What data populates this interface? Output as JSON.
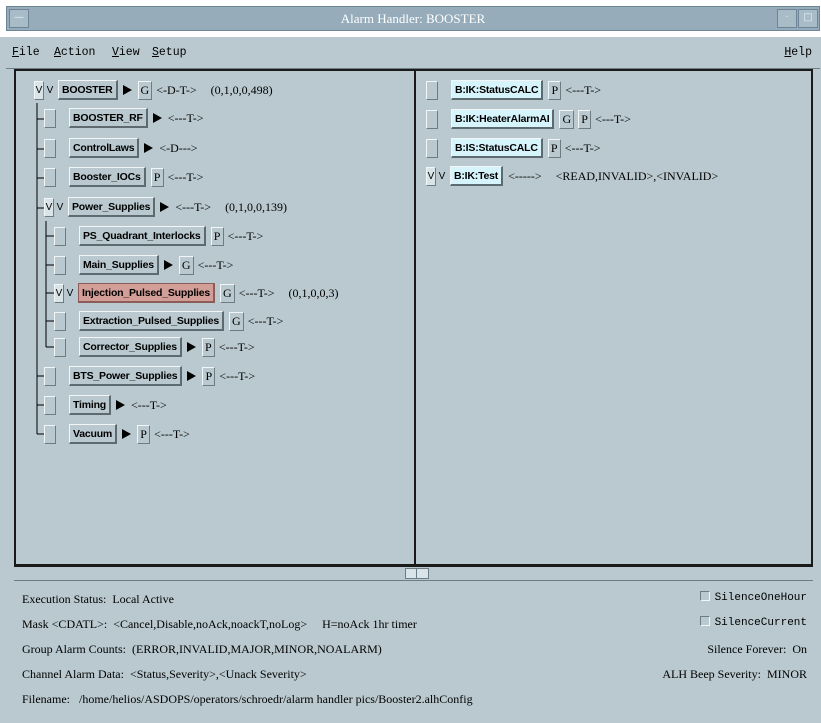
{
  "window": {
    "title": "Alarm Handler: BOOSTER"
  },
  "menubar": {
    "file": "File",
    "action": "Action",
    "view": "View",
    "setup": "Setup",
    "help": "Help"
  },
  "groups": [
    {
      "name": "BOOSTER",
      "flags": [
        "V",
        "V"
      ],
      "arrow": true,
      "buttons": [
        "G"
      ],
      "status": "<-D-T->",
      "counts": "(0,1,0,0,498)"
    },
    {
      "name": "BOOSTER_RF",
      "flags": [],
      "arrow": true,
      "buttons": [],
      "status": "<---T->",
      "counts": ""
    },
    {
      "name": "ControlLaws",
      "flags": [],
      "arrow": true,
      "buttons": [],
      "status": "<-D--->",
      "counts": ""
    },
    {
      "name": "Booster_IOCs",
      "flags": [],
      "arrow": false,
      "buttons": [
        "P"
      ],
      "status": "<---T->",
      "counts": ""
    },
    {
      "name": "Power_Supplies",
      "flags": [
        "V",
        "V"
      ],
      "arrow": true,
      "buttons": [],
      "status": "<---T->",
      "counts": "(0,1,0,0,139)"
    },
    {
      "name": "PS_Quadrant_Interlocks",
      "flags": [],
      "arrow": false,
      "buttons": [
        "P"
      ],
      "status": "<---T->",
      "counts": ""
    },
    {
      "name": "Main_Supplies",
      "flags": [],
      "arrow": true,
      "buttons": [
        "G"
      ],
      "status": "<---T->",
      "counts": ""
    },
    {
      "name": "Injection_Pulsed_Supplies",
      "flags": [
        "V",
        "V"
      ],
      "arrow": false,
      "buttons": [
        "G"
      ],
      "status": "<---T->",
      "counts": "(0,1,0,0,3)"
    },
    {
      "name": "Extraction_Pulsed_Supplies",
      "flags": [],
      "arrow": false,
      "buttons": [
        "G"
      ],
      "status": "<---T->",
      "counts": ""
    },
    {
      "name": "Corrector_Supplies",
      "flags": [],
      "arrow": true,
      "buttons": [
        "P"
      ],
      "status": "<---T->",
      "counts": ""
    },
    {
      "name": "BTS_Power_Supplies",
      "flags": [],
      "arrow": true,
      "buttons": [
        "P"
      ],
      "status": "<---T->",
      "counts": ""
    },
    {
      "name": "Timing",
      "flags": [],
      "arrow": true,
      "buttons": [],
      "status": "<---T->",
      "counts": ""
    },
    {
      "name": "Vacuum",
      "flags": [],
      "arrow": true,
      "buttons": [
        "P"
      ],
      "status": "<---T->",
      "counts": ""
    }
  ],
  "channels": [
    {
      "name": "B:IK:StatusCALC",
      "flags": [],
      "buttons": [
        "P"
      ],
      "status": "<---T->",
      "data": ""
    },
    {
      "name": "B:IK:HeaterAlarmAI",
      "flags": [],
      "buttons": [
        "G",
        "P"
      ],
      "status": "<---T->",
      "data": ""
    },
    {
      "name": "B:IS:StatusCALC",
      "flags": [],
      "buttons": [
        "P"
      ],
      "status": "<---T->",
      "data": ""
    },
    {
      "name": "B:IK:Test",
      "flags": [
        "V",
        "V"
      ],
      "buttons": [],
      "status": "<----->",
      "data": "<READ,INVALID>,<INVALID>"
    }
  ],
  "status_area": {
    "execution_label": "Execution Status:",
    "execution_value": "Local Active",
    "mask_label": "Mask <CDATL>:",
    "mask_value": "<Cancel,Disable,noAck,noackT,noLog>",
    "mask_note": "H=noAck 1hr timer",
    "group_counts_label": "Group Alarm Counts:",
    "group_counts_value": "(ERROR,INVALID,MAJOR,MINOR,NOALARM)",
    "channel_data_label": "Channel Alarm Data:",
    "channel_data_value": "<Status,Severity>,<Unack Severity>",
    "filename_label": "Filename:",
    "filename_value": "/home/helios/ASDOPS/operators/schroedr/alarm handler pics/Booster2.alhConfig",
    "silence_one_hour": "SilenceOneHour",
    "silence_current": "SilenceCurrent",
    "silence_forever_label": "Silence Forever:",
    "silence_forever_value": "On",
    "beep_severity_label": "ALH Beep Severity:",
    "beep_severity_value": "MINOR"
  },
  "colors": {
    "background": "#b9c9cf",
    "titlebar": "#96acba",
    "selected_group": "#d39d98",
    "channel_button": "#d6f4fb"
  }
}
